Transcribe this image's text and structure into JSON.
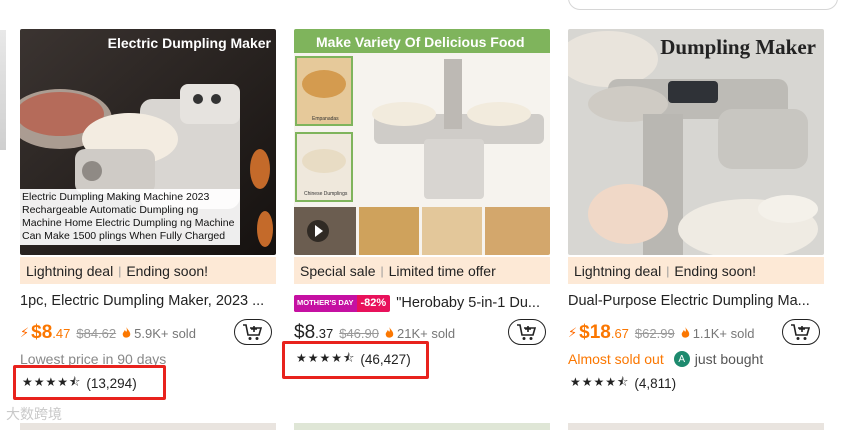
{
  "watermark": "大数跨境",
  "colors": {
    "accent": "#fb7701",
    "deal_bg": "#fde9d6",
    "highlight": "#e8221d",
    "promo": "#e8115b"
  },
  "cards": [
    {
      "image_caption": "Electric Dumpling Maker",
      "image_overlay": "Electric Dumpling Making Machine 2023 Rechargeable Automatic Dumpling ng Machine Home Electric Dumpling ng Machine Can Make 1500 plings When Fully Charged",
      "deal_label": "Lightning deal",
      "deal_status": "Ending soon!",
      "title": "1pc, Electric Dumpling Maker, 2023 ...",
      "price_main": "$8",
      "price_cents": ".47",
      "price_original": "$84.62",
      "sold": "5.9K+ sold",
      "note": "Lowest price in 90 days",
      "stars": "★★★★⯪",
      "rating_count": "(13,294)"
    },
    {
      "image_caption": "Make Variety Of Delicious Food",
      "image_labels": [
        "Empanadas",
        "Chinese Dumplings"
      ],
      "deal_label": "Special sale",
      "deal_status": "Limited time offer",
      "promo_badge_left": "MOTHER'S DAY",
      "promo_badge_right": "-82%",
      "title": "\"Herobaby 5-in-1 Du...",
      "price_main": "$8",
      "price_cents": ".37",
      "price_original": "$46.90",
      "sold": "21K+ sold",
      "stars": "★★★★⯪",
      "rating_count": "(46,427)"
    },
    {
      "image_caption": "Dumpling Maker",
      "deal_label": "Lightning deal",
      "deal_status": "Ending soon!",
      "title": "Dual-Purpose Electric Dumpling Ma...",
      "price_main": "$18",
      "price_cents": ".67",
      "price_original": "$62.99",
      "sold": "1.1K+ sold",
      "note": "Almost sold out",
      "avatar_letter": "A",
      "bought_text": "just bought",
      "stars": "★★★★⯪",
      "rating_count": "(4,811)"
    }
  ]
}
